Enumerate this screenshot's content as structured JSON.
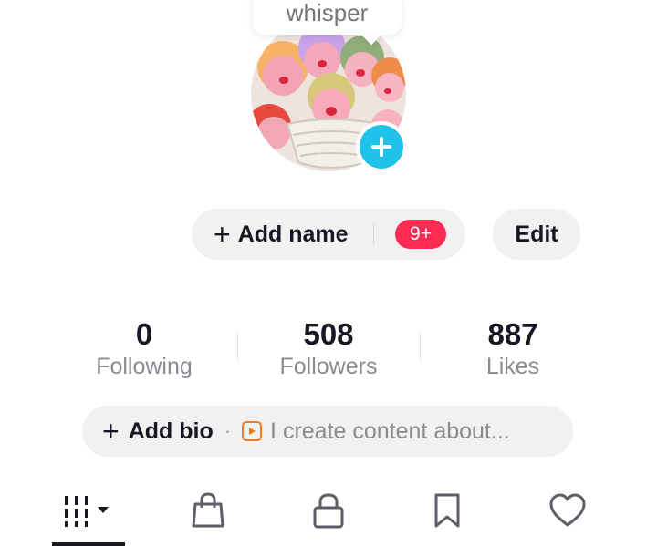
{
  "profile": {
    "username": "whisper",
    "avatar_icon": "plus-icon"
  },
  "actions": {
    "add_name_label": "Add name",
    "badge_count": "9+",
    "edit_label": "Edit"
  },
  "stats": [
    {
      "value": "0",
      "label": "Following"
    },
    {
      "value": "508",
      "label": "Followers"
    },
    {
      "value": "887",
      "label": "Likes"
    }
  ],
  "bio": {
    "add_label": "Add bio",
    "separator": "·",
    "hint": "I create content about..."
  },
  "tabs": [
    {
      "icon": "grid-videos-icon",
      "active": true
    },
    {
      "icon": "shopping-bag-icon",
      "active": false
    },
    {
      "icon": "lock-icon",
      "active": false
    },
    {
      "icon": "bookmark-icon",
      "active": false
    },
    {
      "icon": "heart-icon",
      "active": false
    }
  ],
  "colors": {
    "accent_blue": "#21c2ea",
    "badge_red": "#fe2c55",
    "pill_bg": "#f1f1f2",
    "play_orange": "#f0781e"
  }
}
